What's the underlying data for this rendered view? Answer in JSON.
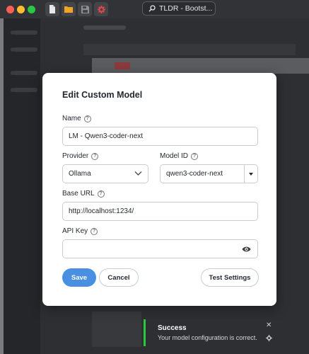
{
  "titlebar": {
    "search_text": "TLDR - Bootst...",
    "icons": [
      "new-file-icon",
      "folder-icon",
      "save-icon",
      "gear-icon"
    ]
  },
  "modal": {
    "title": "Edit Custom Model",
    "name_label": "Name",
    "name_value": "LM - Qwen3-coder-next",
    "provider_label": "Provider",
    "provider_value": "Ollama",
    "model_id_label": "Model ID",
    "model_id_value": "qwen3-coder-next",
    "base_url_label": "Base URL",
    "base_url_value": "http://localhost:1234/",
    "api_key_label": "API Key",
    "api_key_value": "",
    "save_label": "Save",
    "cancel_label": "Cancel",
    "test_label": "Test Settings"
  },
  "toast": {
    "title": "Success",
    "message": "Your model configuration is correct.",
    "accent": "#28c840"
  },
  "colors": {
    "primary": "#4a90e2",
    "close": "#ff5f57",
    "minimize": "#febc2e",
    "zoom": "#28c840"
  }
}
